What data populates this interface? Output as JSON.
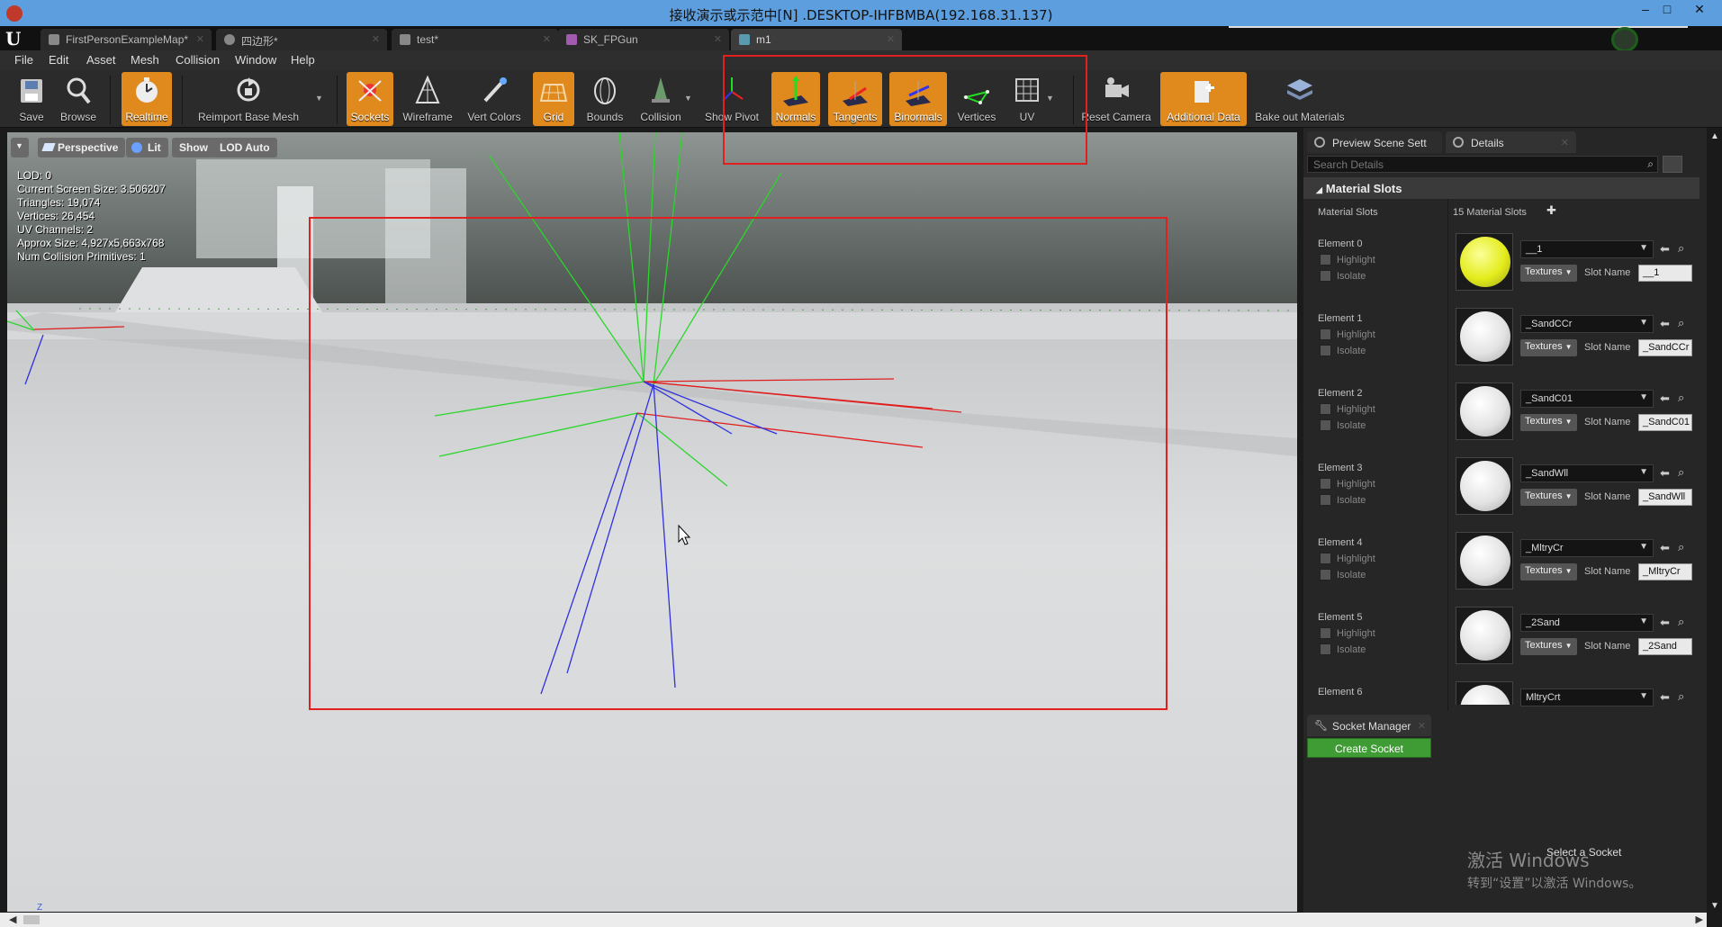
{
  "window": {
    "title": "接收演示或示范中[N] .DESKTOP-IHFBMBA(192.168.31.137)",
    "minimize_glyph": "–",
    "maximize_glyph": "□",
    "close_glyph": "✕"
  },
  "tabs": [
    {
      "label": "FirstPersonExampleMap*",
      "active": false
    },
    {
      "label": "四边形*",
      "active": false
    },
    {
      "label": "test*",
      "active": false
    },
    {
      "label": "SK_FPGun",
      "active": false
    },
    {
      "label": "m1",
      "active": true
    }
  ],
  "menu": [
    "File",
    "Edit",
    "Asset",
    "Mesh",
    "Collision",
    "Window",
    "Help"
  ],
  "toolbar": [
    {
      "label": "Save",
      "icon": "save-icon",
      "active": false
    },
    {
      "label": "Browse",
      "icon": "browse-icon",
      "active": false
    },
    {
      "label": "Realtime",
      "icon": "realtime-icon",
      "active": true
    },
    {
      "label": "Reimport Base Mesh",
      "icon": "reimport-icon",
      "active": false
    },
    {
      "label": "Sockets",
      "icon": "sockets-icon",
      "active": true
    },
    {
      "label": "Wireframe",
      "icon": "wireframe-icon",
      "active": false
    },
    {
      "label": "Vert Colors",
      "icon": "vert-colors-icon",
      "active": false
    },
    {
      "label": "Grid",
      "icon": "grid-icon",
      "active": true
    },
    {
      "label": "Bounds",
      "icon": "bounds-icon",
      "active": false
    },
    {
      "label": "Collision",
      "icon": "collision-icon",
      "active": false
    },
    {
      "label": "Show Pivot",
      "icon": "pivot-icon",
      "active": false
    },
    {
      "label": "Normals",
      "icon": "normals-icon",
      "active": true
    },
    {
      "label": "Tangents",
      "icon": "tangents-icon",
      "active": true
    },
    {
      "label": "Binormals",
      "icon": "binormals-icon",
      "active": true
    },
    {
      "label": "Vertices",
      "icon": "vertices-icon",
      "active": false
    },
    {
      "label": "UV",
      "icon": "uv-icon",
      "active": false
    },
    {
      "label": "Reset Camera",
      "icon": "reset-camera-icon",
      "active": false
    },
    {
      "label": "Additional Data",
      "icon": "additional-data-icon",
      "active": true
    },
    {
      "label": "Bake out Materials",
      "icon": "bake-materials-icon",
      "active": false
    }
  ],
  "viewport": {
    "perspective": "Perspective",
    "lit": "Lit",
    "show": "Show",
    "lod": "LOD Auto",
    "stats": [
      "LOD:  0",
      "Current Screen Size:  3.506207",
      "Triangles:  19,074",
      "Vertices:  26,454",
      "UV Channels:  2",
      "Approx Size: 4,927x5,663x768",
      "Num Collision Primitives:  1"
    ],
    "axis_label": "Z"
  },
  "details": {
    "tab_preview": "Preview Scene Sett",
    "tab_details": "Details",
    "search_placeholder": "Search Details",
    "section": "Material Slots",
    "material_slots_label": "Material Slots",
    "material_slots_count": "15 Material Slots",
    "add_glyph": "✚",
    "highlight": "Highlight",
    "isolate": "Isolate",
    "textures": "Textures",
    "slot_name_label": "Slot Name",
    "elements": [
      {
        "label": "Element 0",
        "material": "__1",
        "slot": "__1",
        "color": "yellow"
      },
      {
        "label": "Element 1",
        "material": "_SandCCr",
        "slot": "_SandCCr",
        "color": "white"
      },
      {
        "label": "Element 2",
        "material": "_SandC01",
        "slot": "_SandC01",
        "color": "white"
      },
      {
        "label": "Element 3",
        "material": "_SandWll",
        "slot": "_SandWll",
        "color": "white"
      },
      {
        "label": "Element 4",
        "material": "_MltryCr",
        "slot": "_MltryCr",
        "color": "white"
      },
      {
        "label": "Element 5",
        "material": "_2Sand",
        "slot": "_2Sand",
        "color": "white"
      },
      {
        "label": "Element 6",
        "material": "MltryCrt",
        "slot": "",
        "color": "white"
      }
    ]
  },
  "socket_manager": {
    "title": "Socket Manager",
    "create_button": "Create Socket",
    "select_text": "Select a Socket"
  },
  "watermark": {
    "line1": "激活 Windows",
    "line2": "转到“设置”以激活 Windows。"
  },
  "colors": {
    "accent_orange": "#e08a1e",
    "highlight_red": "#e32020",
    "create_green": "#3f9c34",
    "normals_green": "#2bd62b",
    "tangents_red": "#e02020",
    "binormals_blue": "#3030e0"
  }
}
